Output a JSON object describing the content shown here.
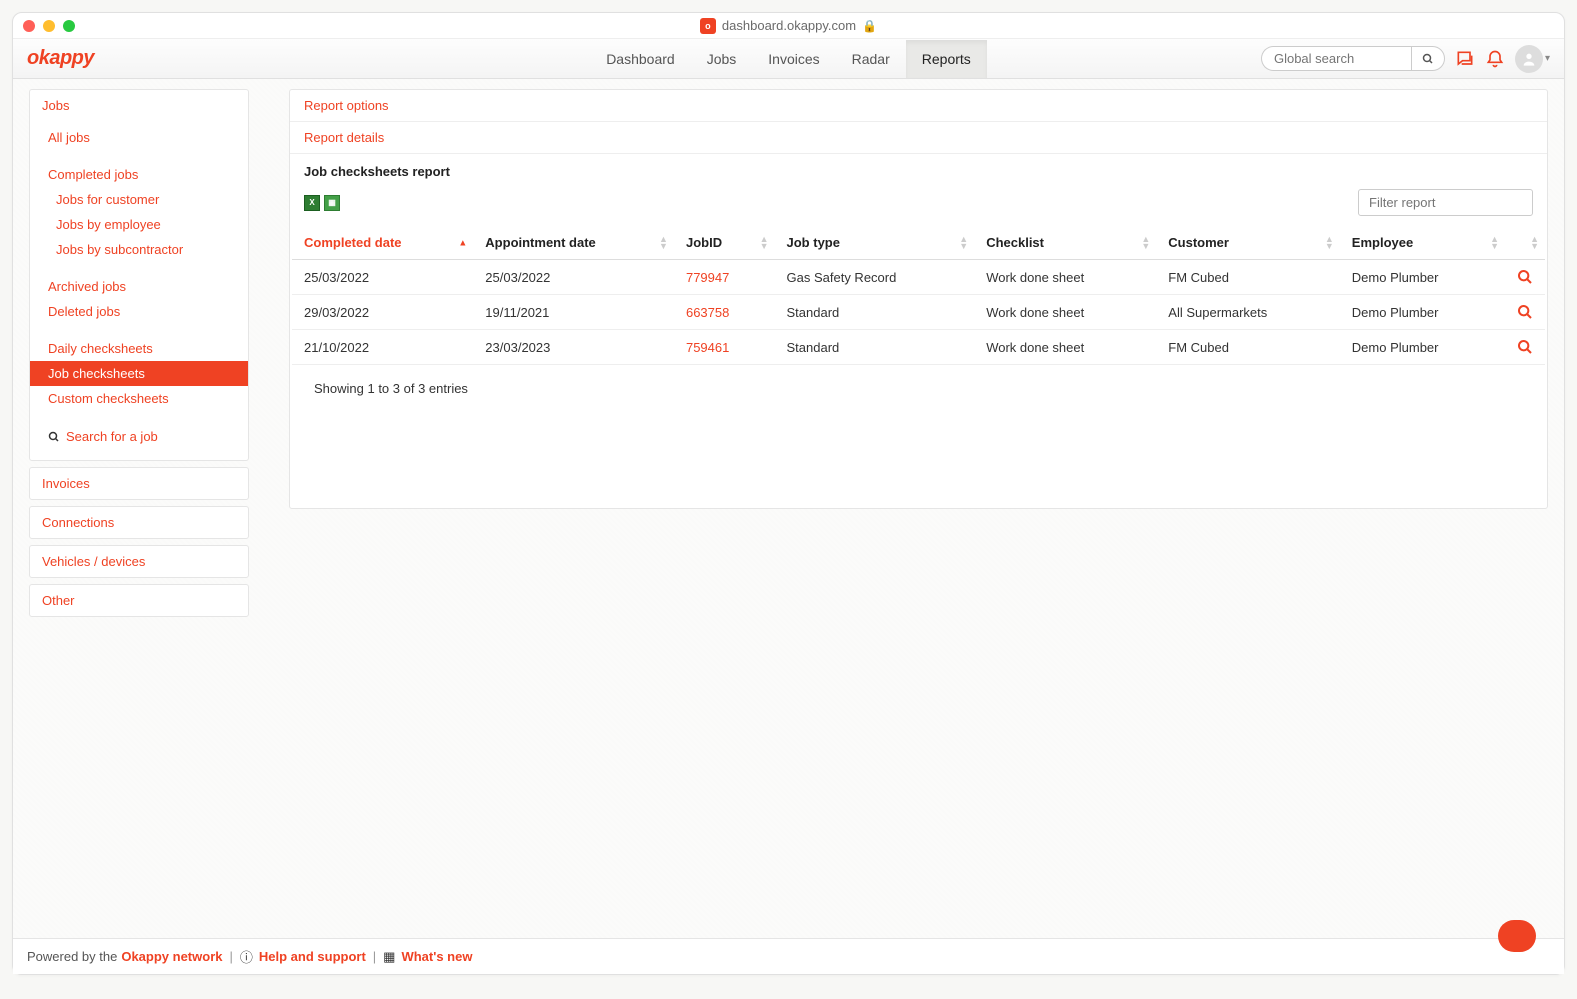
{
  "browser": {
    "url": "dashboard.okappy.com"
  },
  "brand": "okappy",
  "nav": {
    "items": [
      "Dashboard",
      "Jobs",
      "Invoices",
      "Radar",
      "Reports"
    ],
    "active": "Reports"
  },
  "search": {
    "placeholder": "Global search"
  },
  "sidebar": {
    "jobs": {
      "title": "Jobs",
      "all_jobs": "All jobs",
      "completed_jobs": "Completed jobs",
      "jobs_for_customer": "Jobs for customer",
      "jobs_by_employee": "Jobs by employee",
      "jobs_by_subcontractor": "Jobs by subcontractor",
      "archived_jobs": "Archived jobs",
      "deleted_jobs": "Deleted jobs",
      "daily_checksheets": "Daily checksheets",
      "job_checksheets": "Job checksheets",
      "custom_checksheets": "Custom checksheets",
      "search_for_job": "Search for a job"
    },
    "invoices": "Invoices",
    "connections": "Connections",
    "vehicles": "Vehicles / devices",
    "other": "Other"
  },
  "report": {
    "options_label": "Report options",
    "details_label": "Report details",
    "title": "Job checksheets report",
    "filter_placeholder": "Filter report",
    "columns": {
      "completed_date": "Completed date",
      "appointment_date": "Appointment date",
      "job_id": "JobID",
      "job_type": "Job type",
      "checklist": "Checklist",
      "customer": "Customer",
      "employee": "Employee"
    },
    "rows": [
      {
        "completed_date": "25/03/2022",
        "appointment_date": "25/03/2022",
        "job_id": "779947",
        "job_type": "Gas Safety Record",
        "checklist": "Work done sheet",
        "customer": "FM Cubed",
        "employee": "Demo Plumber"
      },
      {
        "completed_date": "29/03/2022",
        "appointment_date": "19/11/2021",
        "job_id": "663758",
        "job_type": "Standard",
        "checklist": "Work done sheet",
        "customer": "All Supermarkets",
        "employee": "Demo Plumber"
      },
      {
        "completed_date": "21/10/2022",
        "appointment_date": "23/03/2023",
        "job_id": "759461",
        "job_type": "Standard",
        "checklist": "Work done sheet",
        "customer": "FM Cubed",
        "employee": "Demo Plumber"
      }
    ],
    "footer_info": "Showing 1 to 3 of 3 entries"
  },
  "footer": {
    "powered_by_prefix": "Powered by the ",
    "network": "Okappy network",
    "help": "Help and support",
    "whats_new": "What's new"
  }
}
